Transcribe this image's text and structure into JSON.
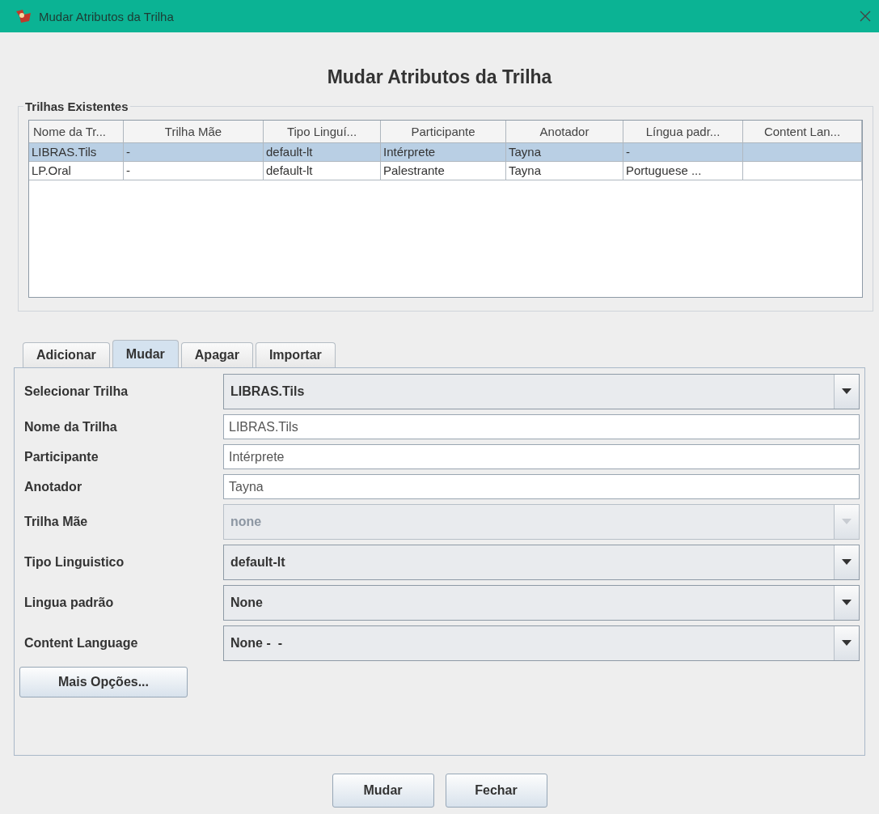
{
  "window": {
    "title": "Mudar Atributos da Trilha"
  },
  "heading": "Mudar Atributos da Trilha",
  "group": {
    "title": "Trilhas Existentes"
  },
  "table": {
    "columns": [
      "Nome da Tr...",
      "Trilha Mãe",
      "Tipo Linguí...",
      "Participante",
      "Anotador",
      "Língua padr...",
      "Content Lan..."
    ],
    "rows": [
      {
        "selected": true,
        "cells": [
          "LIBRAS.Tils",
          "-",
          "default-lt",
          "Intérprete",
          "Tayna",
          "-",
          ""
        ]
      },
      {
        "selected": false,
        "cells": [
          "LP.Oral",
          "-",
          "default-lt",
          "Palestrante",
          "Tayna",
          "Portuguese ...",
          ""
        ]
      }
    ]
  },
  "tabs": [
    {
      "label": "Adicionar",
      "selected": false
    },
    {
      "label": "Mudar",
      "selected": true
    },
    {
      "label": "Apagar",
      "selected": false
    },
    {
      "label": "Importar",
      "selected": false
    }
  ],
  "form": [
    {
      "label": "Selecionar Trilha",
      "kind": "combo",
      "value": "LIBRAS.Tils",
      "disabled": false
    },
    {
      "label": "Nome da Trilha",
      "kind": "text",
      "value": "LIBRAS.Tils"
    },
    {
      "label": "Participante",
      "kind": "text",
      "value": "Intérprete"
    },
    {
      "label": "Anotador",
      "kind": "text",
      "value": "Tayna"
    },
    {
      "label": "Trilha Mãe",
      "kind": "combo",
      "value": "none",
      "disabled": true
    },
    {
      "label": "Tipo Linguistico",
      "kind": "combo",
      "value": "default-lt",
      "disabled": false
    },
    {
      "label": "Lingua padrão",
      "kind": "combo",
      "value": "None",
      "disabled": false
    },
    {
      "label": "Content Language",
      "kind": "combo",
      "value": "None -  -",
      "disabled": false
    }
  ],
  "more_button": "Mais Opções...",
  "buttons": [
    "Mudar",
    "Fechar"
  ]
}
